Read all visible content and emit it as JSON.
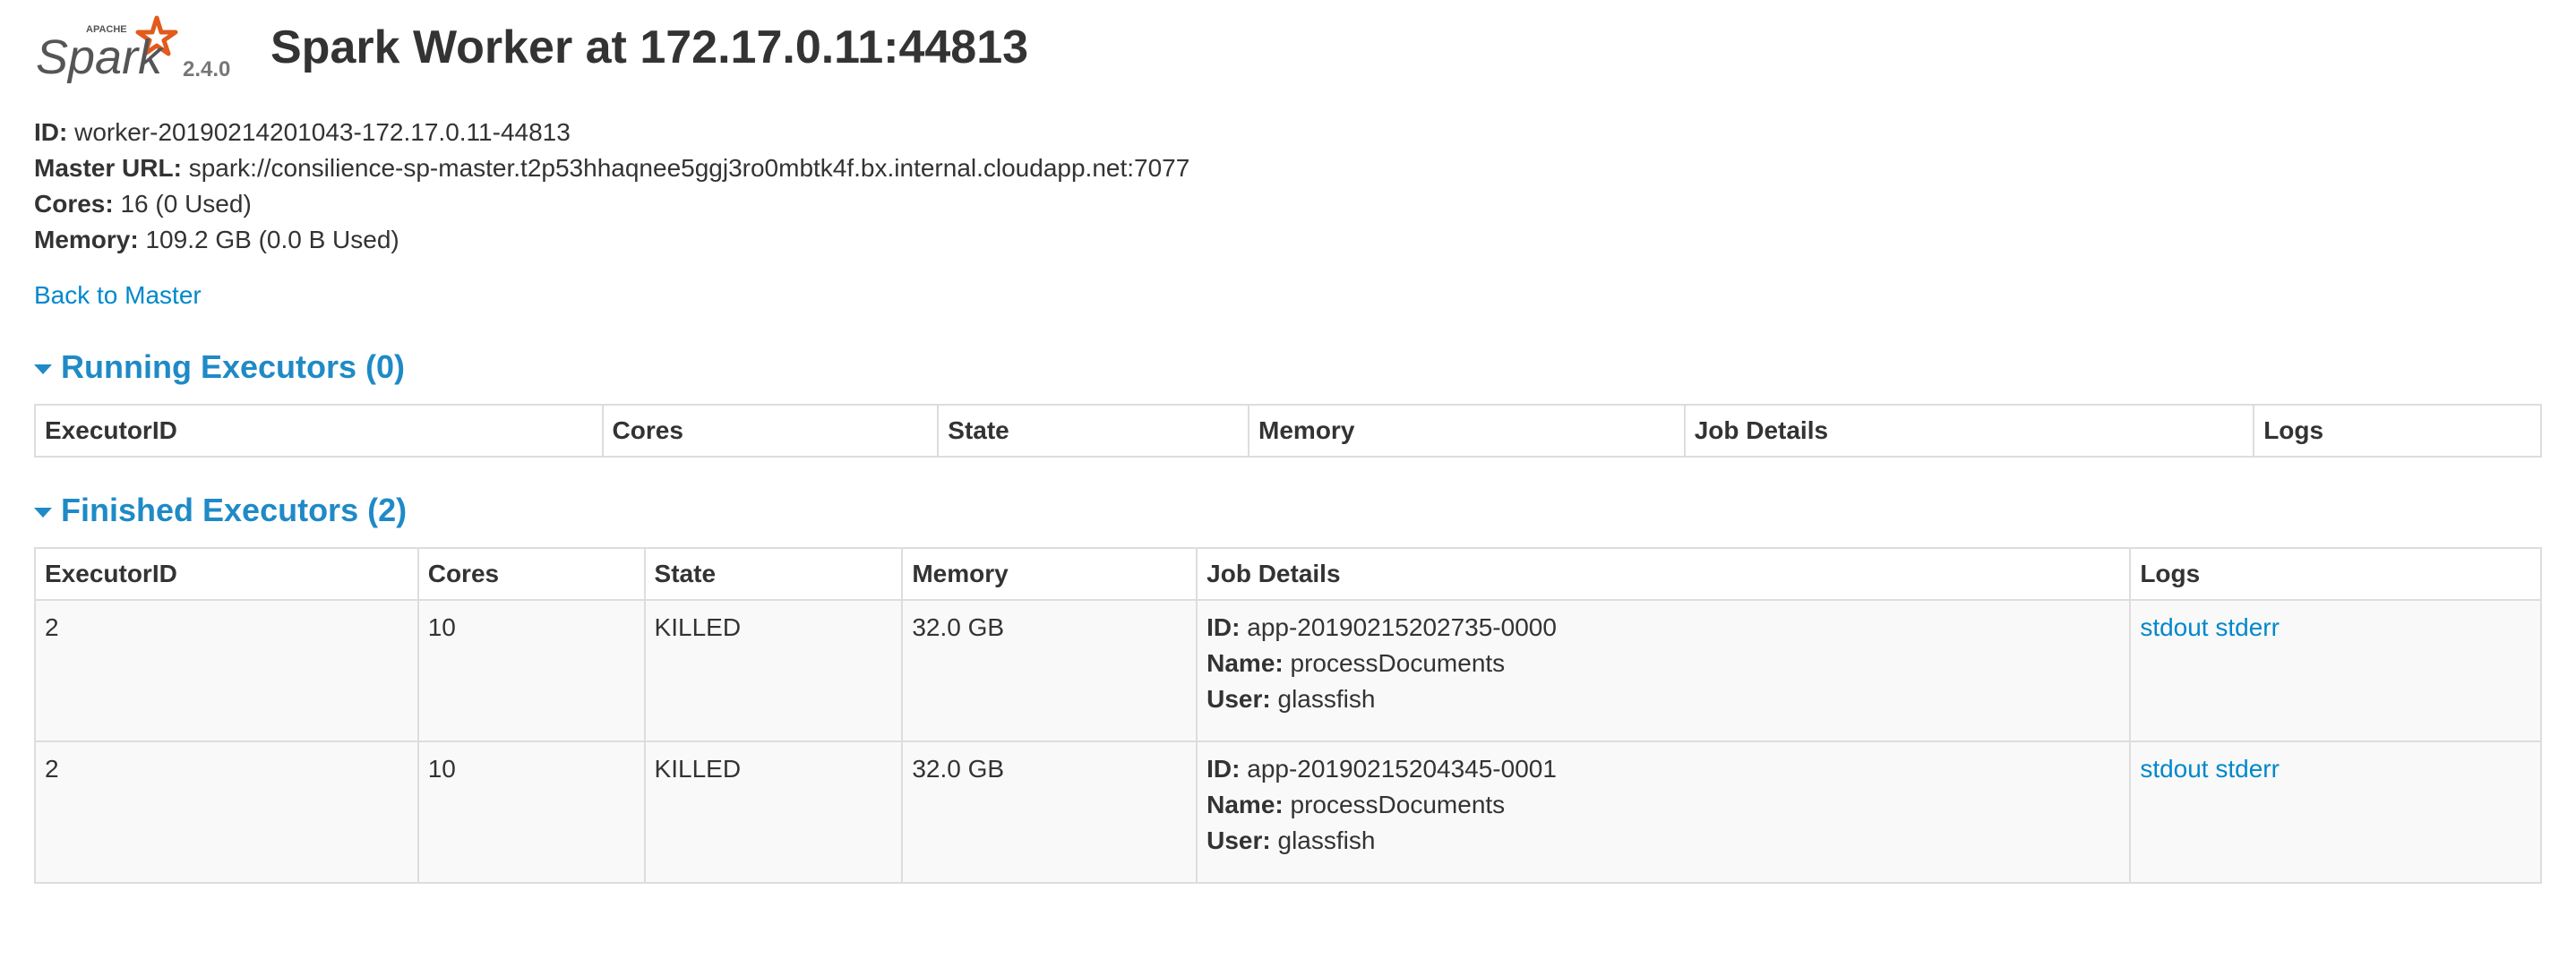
{
  "header": {
    "logo_word": "Spark",
    "logo_small": "APACHE",
    "version": "2.4.0",
    "title": "Spark Worker at 172.17.0.11:44813"
  },
  "summary": {
    "id_label": "ID:",
    "id_value": "worker-20190214201043-172.17.0.11-44813",
    "master_label": "Master URL:",
    "master_value": "spark://consilience-sp-master.t2p53hhaqnee5ggj3ro0mbtk4f.bx.internal.cloudapp.net:7077",
    "cores_label": "Cores:",
    "cores_value": "16 (0 Used)",
    "memory_label": "Memory:",
    "memory_value": "109.2 GB (0.0 B Used)"
  },
  "back_link": "Back to Master",
  "running": {
    "title": "Running Executors (0)",
    "columns": [
      "ExecutorID",
      "Cores",
      "State",
      "Memory",
      "Job Details",
      "Logs"
    ]
  },
  "finished": {
    "title": "Finished Executors (2)",
    "columns": [
      "ExecutorID",
      "Cores",
      "State",
      "Memory",
      "Job Details",
      "Logs"
    ],
    "rows": [
      {
        "executor_id": "2",
        "cores": "10",
        "state": "KILLED",
        "memory": "32.0 GB",
        "id_label": "ID:",
        "app_id": "app-20190215202735-0000",
        "name_label": "Name:",
        "name": "processDocuments",
        "user_label": "User:",
        "user": "glassfish",
        "stdout": "stdout",
        "stderr": "stderr"
      },
      {
        "executor_id": "2",
        "cores": "10",
        "state": "KILLED",
        "memory": "32.0 GB",
        "id_label": "ID:",
        "app_id": "app-20190215204345-0001",
        "name_label": "Name:",
        "name": "processDocuments",
        "user_label": "User:",
        "user": "glassfish",
        "stdout": "stdout",
        "stderr": "stderr"
      }
    ]
  },
  "colors": {
    "link": "#0088cc",
    "section": "#1f8ac6",
    "logo_star": "#e25a1c",
    "text": "#333333"
  }
}
